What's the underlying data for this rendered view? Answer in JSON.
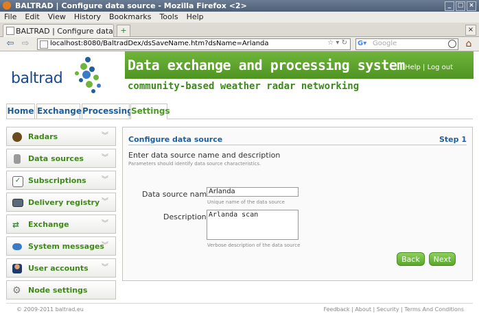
{
  "window": {
    "title": "BALTRAD | Configure data source - Mozilla Firefox <2>",
    "min": "_",
    "max": "□",
    "close": "×"
  },
  "menu": [
    "File",
    "Edit",
    "View",
    "History",
    "Bookmarks",
    "Tools",
    "Help"
  ],
  "browser_tab": {
    "label": "BALTRAD | Configure data source",
    "new_tab": "+",
    "close": "×"
  },
  "nav": {
    "url": "localhost:8080/BaltradDex/dsSaveName.htm?dsName=Arlanda",
    "search_placeholder": "Google",
    "back": "⇦",
    "forward": "⇨"
  },
  "site": {
    "logo_text": "baltrad",
    "banner_title": "Data exchange and processing system",
    "banner_links": "Help | Log out",
    "subtitle": "community-based weather radar networking"
  },
  "page_tabs": [
    {
      "label": "Home"
    },
    {
      "label": "Exchange"
    },
    {
      "label": "Processing"
    },
    {
      "label": "Settings"
    }
  ],
  "sidebar": [
    {
      "label": "Radars",
      "icon": "radar-icon",
      "color": "#6b4a1e"
    },
    {
      "label": "Data sources",
      "icon": "database-icon",
      "color": "#8a8a8a"
    },
    {
      "label": "Subscriptions",
      "icon": "checkbox-icon",
      "color": "#7a7a7a"
    },
    {
      "label": "Delivery registry",
      "icon": "monitor-icon",
      "color": "#5a6a7a"
    },
    {
      "label": "Exchange",
      "icon": "exchange-icon",
      "color": "#3a8a3a"
    },
    {
      "label": "System messages",
      "icon": "message-icon",
      "color": "#3a7ac8"
    },
    {
      "label": "User accounts",
      "icon": "user-icon",
      "color": "#a0522d"
    },
    {
      "label": "Node settings",
      "icon": "gear-icon",
      "color": "#8a8a8a"
    }
  ],
  "panel": {
    "title": "Configure data source",
    "step": "Step 1",
    "intro": "Enter data source name and description",
    "hint": "Parameters should identify data source characteristics.",
    "name_label": "Data source name",
    "name_value": "Arlanda",
    "name_hint": "Unique name of the data source",
    "desc_label": "Description",
    "desc_value": "Arlanda scan",
    "desc_hint": "Verbose description of the data source",
    "back_label": "Back",
    "next_label": "Next"
  },
  "footer": {
    "copyright": "© 2009-2011 baltrad.eu",
    "links": "Feedback | About | Security | Terms And Conditions"
  }
}
